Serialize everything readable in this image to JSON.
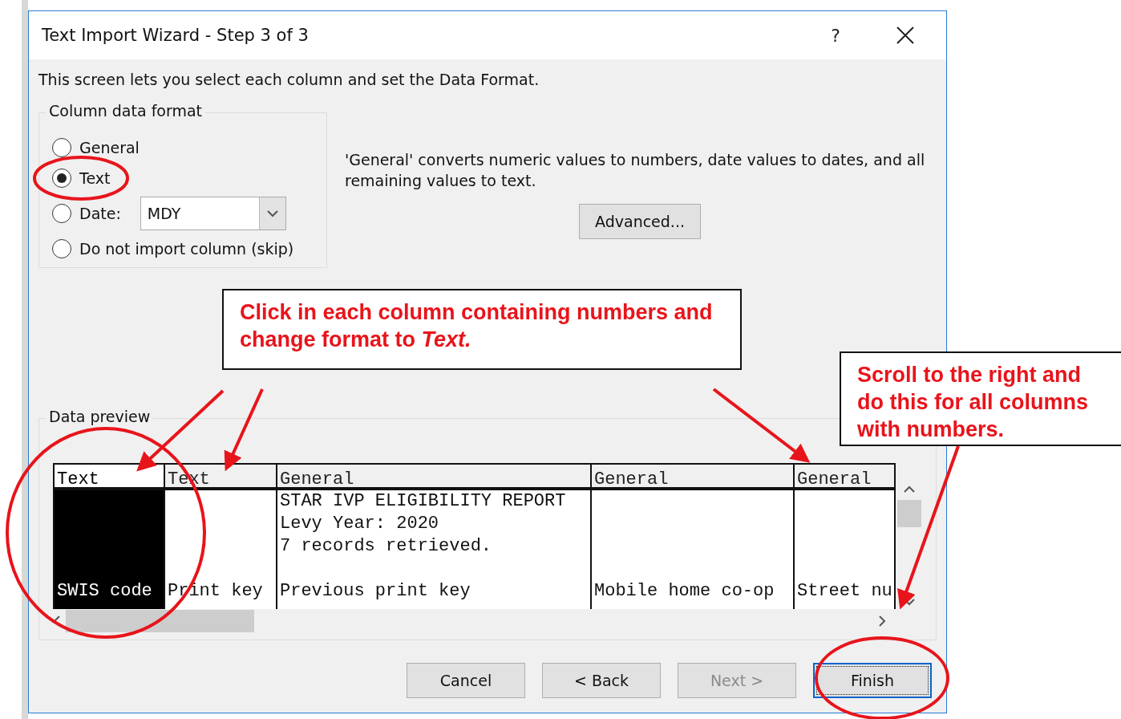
{
  "window": {
    "title": "Text Import Wizard - Step 3 of 3",
    "help": "?"
  },
  "intro": "This screen lets you select each column and set the Data Format.",
  "column_format": {
    "legend": "Column data format",
    "date_format": "MDY",
    "options": [
      {
        "kind": "radio",
        "label": "General",
        "selected": false
      },
      {
        "kind": "radio",
        "label": "Text",
        "selected": true
      },
      {
        "kind": "date",
        "label": "Date:",
        "selected": false
      },
      {
        "kind": "radio",
        "label": "Do not import column (skip)",
        "selected": false
      }
    ]
  },
  "description": "'General' converts numeric values to numbers, date values to dates, and all remaining values to text.",
  "advanced_button": "Advanced...",
  "data_preview": {
    "legend": "Data preview",
    "columns": [
      {
        "format": "Text",
        "selected": true
      },
      {
        "format": "Text",
        "selected": false
      },
      {
        "format": "General",
        "selected": false
      },
      {
        "format": "General",
        "selected": false
      },
      {
        "format": "General",
        "selected": false
      }
    ],
    "rows": [
      {
        "cells": [
          null,
          null,
          "STAR IVP ELIGIBILITY REPORT",
          null,
          null
        ]
      },
      {
        "cells": [
          null,
          null,
          "Levy Year: 2020",
          null,
          null
        ]
      },
      {
        "cells": [
          null,
          null,
          "7 records retrieved.",
          null,
          null
        ]
      },
      {
        "cells": [
          null,
          null,
          null,
          null,
          null
        ]
      },
      {
        "cells": [
          "SWIS code",
          "Print key",
          "Previous print key",
          "Mobile home co-op",
          "Street nu"
        ]
      }
    ]
  },
  "buttons": [
    {
      "label": "Cancel",
      "disabled": false,
      "default": false
    },
    {
      "label": "< Back",
      "disabled": false,
      "default": false
    },
    {
      "label": "Next >",
      "disabled": true,
      "default": false
    },
    {
      "label": "Finish",
      "disabled": false,
      "default": true
    }
  ],
  "annotations": [
    {
      "kind": "callout",
      "text": "Click in each column containing numbers and change format  to **Text.**"
    },
    {
      "kind": "callout",
      "text": "Scroll to the right and do this for all columns with numbers."
    }
  ]
}
